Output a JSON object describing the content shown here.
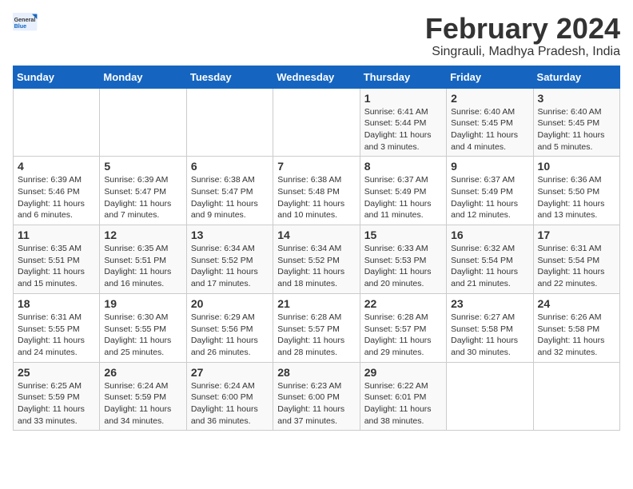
{
  "header": {
    "logo_general": "General",
    "logo_blue": "Blue",
    "month_title": "February 2024",
    "location": "Singrauli, Madhya Pradesh, India"
  },
  "weekdays": [
    "Sunday",
    "Monday",
    "Tuesday",
    "Wednesday",
    "Thursday",
    "Friday",
    "Saturday"
  ],
  "weeks": [
    [
      {
        "day": "",
        "info": ""
      },
      {
        "day": "",
        "info": ""
      },
      {
        "day": "",
        "info": ""
      },
      {
        "day": "",
        "info": ""
      },
      {
        "day": "1",
        "info": "Sunrise: 6:41 AM\nSunset: 5:44 PM\nDaylight: 11 hours\nand 3 minutes."
      },
      {
        "day": "2",
        "info": "Sunrise: 6:40 AM\nSunset: 5:45 PM\nDaylight: 11 hours\nand 4 minutes."
      },
      {
        "day": "3",
        "info": "Sunrise: 6:40 AM\nSunset: 5:45 PM\nDaylight: 11 hours\nand 5 minutes."
      }
    ],
    [
      {
        "day": "4",
        "info": "Sunrise: 6:39 AM\nSunset: 5:46 PM\nDaylight: 11 hours\nand 6 minutes."
      },
      {
        "day": "5",
        "info": "Sunrise: 6:39 AM\nSunset: 5:47 PM\nDaylight: 11 hours\nand 7 minutes."
      },
      {
        "day": "6",
        "info": "Sunrise: 6:38 AM\nSunset: 5:47 PM\nDaylight: 11 hours\nand 9 minutes."
      },
      {
        "day": "7",
        "info": "Sunrise: 6:38 AM\nSunset: 5:48 PM\nDaylight: 11 hours\nand 10 minutes."
      },
      {
        "day": "8",
        "info": "Sunrise: 6:37 AM\nSunset: 5:49 PM\nDaylight: 11 hours\nand 11 minutes."
      },
      {
        "day": "9",
        "info": "Sunrise: 6:37 AM\nSunset: 5:49 PM\nDaylight: 11 hours\nand 12 minutes."
      },
      {
        "day": "10",
        "info": "Sunrise: 6:36 AM\nSunset: 5:50 PM\nDaylight: 11 hours\nand 13 minutes."
      }
    ],
    [
      {
        "day": "11",
        "info": "Sunrise: 6:35 AM\nSunset: 5:51 PM\nDaylight: 11 hours\nand 15 minutes."
      },
      {
        "day": "12",
        "info": "Sunrise: 6:35 AM\nSunset: 5:51 PM\nDaylight: 11 hours\nand 16 minutes."
      },
      {
        "day": "13",
        "info": "Sunrise: 6:34 AM\nSunset: 5:52 PM\nDaylight: 11 hours\nand 17 minutes."
      },
      {
        "day": "14",
        "info": "Sunrise: 6:34 AM\nSunset: 5:52 PM\nDaylight: 11 hours\nand 18 minutes."
      },
      {
        "day": "15",
        "info": "Sunrise: 6:33 AM\nSunset: 5:53 PM\nDaylight: 11 hours\nand 20 minutes."
      },
      {
        "day": "16",
        "info": "Sunrise: 6:32 AM\nSunset: 5:54 PM\nDaylight: 11 hours\nand 21 minutes."
      },
      {
        "day": "17",
        "info": "Sunrise: 6:31 AM\nSunset: 5:54 PM\nDaylight: 11 hours\nand 22 minutes."
      }
    ],
    [
      {
        "day": "18",
        "info": "Sunrise: 6:31 AM\nSunset: 5:55 PM\nDaylight: 11 hours\nand 24 minutes."
      },
      {
        "day": "19",
        "info": "Sunrise: 6:30 AM\nSunset: 5:55 PM\nDaylight: 11 hours\nand 25 minutes."
      },
      {
        "day": "20",
        "info": "Sunrise: 6:29 AM\nSunset: 5:56 PM\nDaylight: 11 hours\nand 26 minutes."
      },
      {
        "day": "21",
        "info": "Sunrise: 6:28 AM\nSunset: 5:57 PM\nDaylight: 11 hours\nand 28 minutes."
      },
      {
        "day": "22",
        "info": "Sunrise: 6:28 AM\nSunset: 5:57 PM\nDaylight: 11 hours\nand 29 minutes."
      },
      {
        "day": "23",
        "info": "Sunrise: 6:27 AM\nSunset: 5:58 PM\nDaylight: 11 hours\nand 30 minutes."
      },
      {
        "day": "24",
        "info": "Sunrise: 6:26 AM\nSunset: 5:58 PM\nDaylight: 11 hours\nand 32 minutes."
      }
    ],
    [
      {
        "day": "25",
        "info": "Sunrise: 6:25 AM\nSunset: 5:59 PM\nDaylight: 11 hours\nand 33 minutes."
      },
      {
        "day": "26",
        "info": "Sunrise: 6:24 AM\nSunset: 5:59 PM\nDaylight: 11 hours\nand 34 minutes."
      },
      {
        "day": "27",
        "info": "Sunrise: 6:24 AM\nSunset: 6:00 PM\nDaylight: 11 hours\nand 36 minutes."
      },
      {
        "day": "28",
        "info": "Sunrise: 6:23 AM\nSunset: 6:00 PM\nDaylight: 11 hours\nand 37 minutes."
      },
      {
        "day": "29",
        "info": "Sunrise: 6:22 AM\nSunset: 6:01 PM\nDaylight: 11 hours\nand 38 minutes."
      },
      {
        "day": "",
        "info": ""
      },
      {
        "day": "",
        "info": ""
      }
    ]
  ]
}
